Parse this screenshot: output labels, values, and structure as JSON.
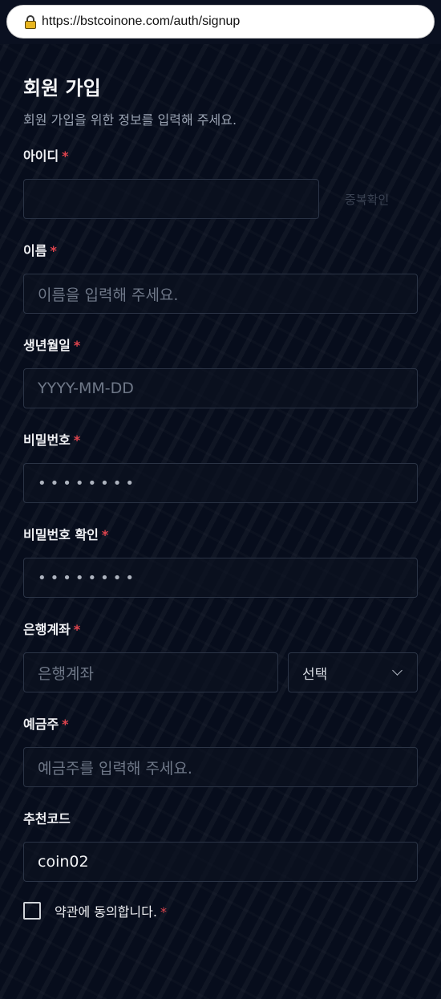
{
  "browser": {
    "url": "https://bstcoinone.com/auth/signup"
  },
  "form": {
    "title": "회원 가입",
    "subtitle": "회원 가입을 위한 정보를 입력해 주세요.",
    "required_mark": "*",
    "userid": {
      "label": "아이디",
      "value": "",
      "check_button": "중복확인"
    },
    "name": {
      "label": "이름",
      "placeholder": "이름을 입력해 주세요."
    },
    "birth": {
      "label": "생년월일",
      "placeholder": "YYYY-MM-DD"
    },
    "password": {
      "label": "비밀번호",
      "masked": "••••••••"
    },
    "password_confirm": {
      "label": "비밀번호 확인",
      "masked": "••••••••"
    },
    "bank": {
      "label": "은행계좌",
      "placeholder": "은행계좌",
      "select_value": "선택"
    },
    "holder": {
      "label": "예금주",
      "placeholder": "예금주를 입력해 주세요."
    },
    "referral": {
      "label": "추천코드",
      "value": "coin02"
    },
    "agree": {
      "label": "약관에 동의합니다.",
      "checked": false
    }
  },
  "colors": {
    "background": "#070d1c",
    "required": "#e0444e",
    "border": "#2b3446"
  }
}
